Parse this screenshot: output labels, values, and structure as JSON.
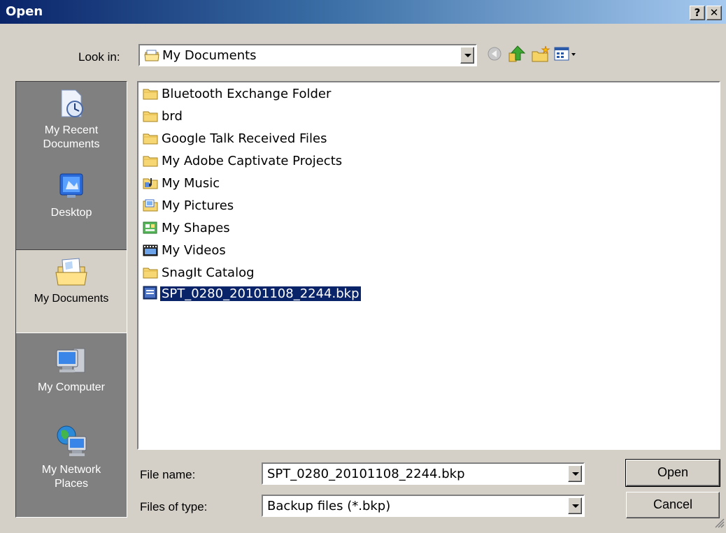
{
  "window": {
    "title": "Open",
    "help_label": "?",
    "close_label": "✕"
  },
  "look_in": {
    "label": "Look in:",
    "value": "My Documents",
    "icon": "my-documents-icon"
  },
  "toolbar": {
    "back_icon": "back-icon",
    "up_icon": "up-folder-icon",
    "new_folder_icon": "new-folder-icon",
    "views_icon": "views-menu-icon"
  },
  "places": [
    {
      "label": "My Recent Documents",
      "icon": "recent-documents-icon",
      "active": false
    },
    {
      "label": "Desktop",
      "icon": "desktop-icon",
      "active": false
    },
    {
      "label": "My Documents",
      "icon": "my-documents-icon",
      "active": true
    },
    {
      "label": "My Computer",
      "icon": "my-computer-icon",
      "active": false
    },
    {
      "label": "My Network Places",
      "icon": "network-places-icon",
      "active": false
    }
  ],
  "files": [
    {
      "name": "Bluetooth Exchange Folder",
      "icon": "folder-icon"
    },
    {
      "name": "brd",
      "icon": "folder-icon"
    },
    {
      "name": "Google Talk Received Files",
      "icon": "folder-icon"
    },
    {
      "name": "My Adobe Captivate Projects",
      "icon": "folder-icon"
    },
    {
      "name": "My Music",
      "icon": "music-folder-icon"
    },
    {
      "name": "My Pictures",
      "icon": "pictures-folder-icon"
    },
    {
      "name": "My Shapes",
      "icon": "shapes-folder-icon"
    },
    {
      "name": "My Videos",
      "icon": "videos-folder-icon"
    },
    {
      "name": "SnagIt Catalog",
      "icon": "folder-icon"
    },
    {
      "name": "SPT_0280_20101108_2244.bkp",
      "icon": "bkp-file-icon",
      "selected": true
    }
  ],
  "file_name": {
    "label": "File name:",
    "value": "SPT_0280_20101108_2244.bkp"
  },
  "file_type": {
    "label": "Files of type:",
    "value": "Backup files (*.bkp)"
  },
  "buttons": {
    "open": "Open",
    "cancel": "Cancel"
  },
  "colors": {
    "title_start": "#0a246a",
    "title_end": "#a6caf0",
    "selection": "#0a246a",
    "face": "#d4d0c8"
  }
}
